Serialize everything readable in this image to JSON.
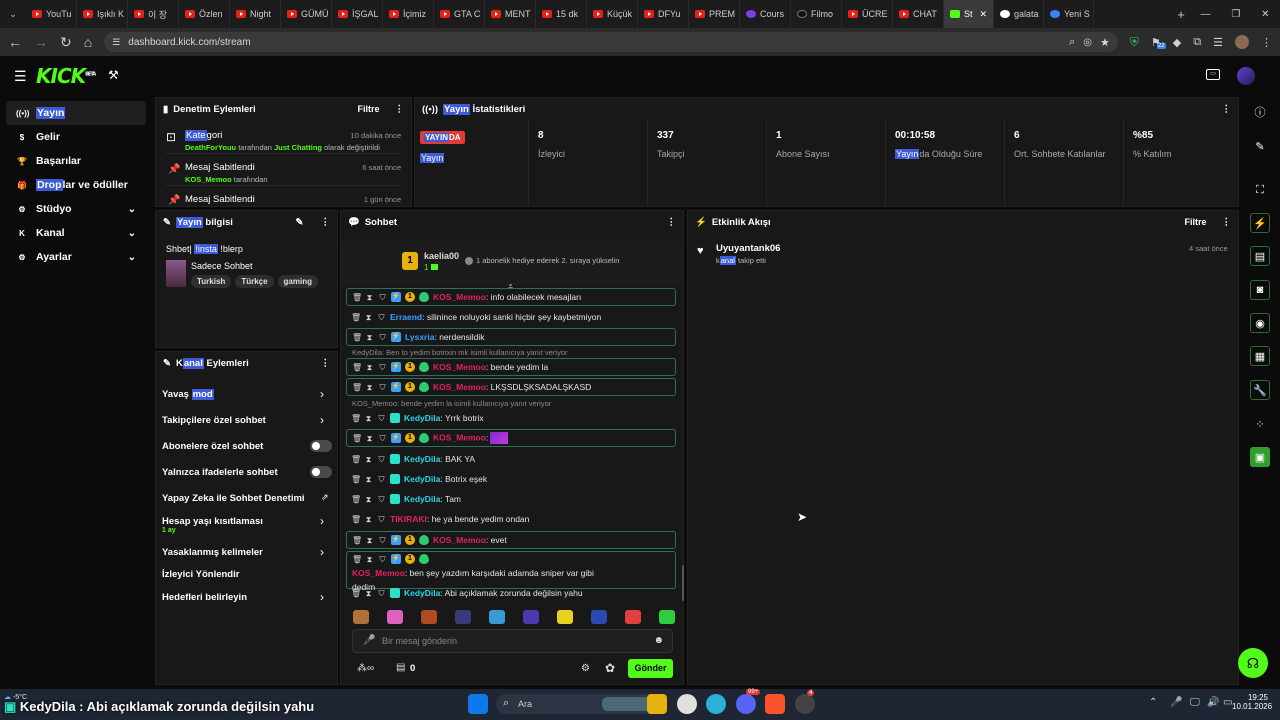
{
  "browser": {
    "tabs": [
      "YouTu",
      "Işıklı K",
      "이 장",
      "Özlen",
      "Night",
      "GÜMÜ",
      "İŞGAL",
      "İçimiz",
      "GTA C",
      "MENT",
      "15 dk",
      "Küçük",
      "DFYu",
      "PREM",
      "Cours",
      "Filmo",
      "ÜCRE",
      "CHAT",
      "St",
      "galata",
      "Yeni S"
    ],
    "url": "dashboard.kick.com/stream",
    "ext_badge": "22"
  },
  "app": {
    "logo": "KICK",
    "beta": "BETA",
    "sidebar": [
      {
        "label_hl": "Yayın",
        "label": "",
        "icon": "broadcast-icon"
      },
      {
        "label_hl": "",
        "label": "Gelir",
        "icon": "dollar-icon"
      },
      {
        "label_hl": "",
        "label": "Başarılar",
        "icon": "trophy-icon"
      },
      {
        "label_hl": "Drop",
        "label": "lar ve ödüller",
        "icon": "gift-icon"
      },
      {
        "label_hl": "",
        "label": "Stüdyo",
        "icon": "gear-icon"
      },
      {
        "label_hl": "",
        "label": "Kanal",
        "icon": "channel-icon"
      },
      {
        "label_hl": "",
        "label": "Ayarlar",
        "icon": "settings-icon"
      }
    ],
    "moderation": {
      "title": "Denetim Eylemleri",
      "filter": "Filtre",
      "items": [
        {
          "title_hl": "Kate",
          "title": "gori",
          "time": "10 dakika önce",
          "line_a": "DeathForYouu",
          "line_b": " tarafından ",
          "line_c": "Just Chatting",
          "line_d": " olarak değiştirildi"
        },
        {
          "title": "Mesaj Sabitlendi",
          "time": "6 saat önce",
          "line_a": "KOS_Memoo",
          "line_b": " tarafından"
        },
        {
          "title": "Mesaj Sabitlendi",
          "time": "1 gün önce"
        }
      ]
    },
    "stats": {
      "title_hl": "Yayın",
      "title": " İstatistikleri",
      "live_badge_hl": "YAYIN",
      "live_badge": "DA",
      "live_sub": "Yayın",
      "items": [
        {
          "value": "8",
          "label": "İzleyici"
        },
        {
          "value": "337",
          "label": "Takipçi"
        },
        {
          "value": "1",
          "label": "Abone Sayısı"
        },
        {
          "value": "00:10:58",
          "label_hl": "Yayın",
          "label": "da Olduğu Süre"
        },
        {
          "value": "6",
          "label": "Ort. Sohbete Katılanlar"
        },
        {
          "value": "%85",
          "label": "% Katılım"
        }
      ]
    },
    "stream_info": {
      "title_hl": "Yayın",
      "title": " bilgisi",
      "stream_title_a": "Shbet| ",
      "stream_title_hl": "!insta",
      "stream_title_b": " !blerp",
      "category": "Sadece Sohbet",
      "tags": [
        "Turkish",
        "Türkçe",
        "gaming"
      ]
    },
    "channel_actions": {
      "title_hl": "anal",
      "title_pre": "K",
      "title": " Eylemleri",
      "items": [
        {
          "label_a": "Yavaş ",
          "label_hl": "mod",
          "type": "chev"
        },
        {
          "label_a": "Takipçilere özel sohbet",
          "type": "chev"
        },
        {
          "label_a": "Abonelere özel sohbet",
          "type": "toggle"
        },
        {
          "label_a": "Yalnızca ifadelerle sohbet",
          "type": "toggle"
        },
        {
          "label_a": "Yapay Zeka ile Sohbet Denetimi",
          "type": "ext"
        },
        {
          "label_a": "Hesap yaşı kısıtlaması",
          "sub": "1 ay",
          "type": "chev"
        },
        {
          "label_a": "Yasaklanmış kelimeler",
          "type": "chev"
        },
        {
          "label_a": "İzleyici Yönlendir",
          "type": "none"
        },
        {
          "label_a": "Hedefleri belirleyin",
          "type": "chev"
        }
      ]
    },
    "chat": {
      "title": "Sohbet",
      "pinned_user": "kaelia00",
      "pinned_level": "1",
      "pinned_msg": "1 abonelik hediye ederek 2. sıraya yükselin",
      "messages": [
        {
          "user": "KOS_Memoo",
          "text": ": info olabilecek mesajları"
        },
        {
          "user": "Erraend",
          "text": ": silinince noluyoki sanki hiçbir şey kaybetmiyon"
        },
        {
          "user": "Lysxria",
          "text": ": nerdensildik"
        },
        {
          "reply": "KedyDila: Ben to yedim botrixin mk isimli kullanıcıya yanıt veriyor",
          "user": "KOS_Memoo",
          "text": ": bende yedim la"
        },
        {
          "user": "KOS_Memoo",
          "text": ": LKŞSDLŞKSADALŞKASD"
        },
        {
          "reply": "KOS_Memoo: bende yedim la isimli kullanıcıya yanıt veriyor",
          "user": "KedyDila",
          "text": ": Yrrk botrix"
        },
        {
          "user": "KOS_Memoo",
          "text": ":"
        },
        {
          "user": "KedyDila",
          "text": ": BAK YA"
        },
        {
          "user": "KedyDila",
          "text": ": Botrix eşek"
        },
        {
          "user": "KedyDila",
          "text": ": Tam"
        },
        {
          "user": "TIKIRAKI",
          "text": ": he ya bende yedim ondan"
        },
        {
          "user": "KOS_Memoo",
          "text": ": evet"
        },
        {
          "user": "KOS_Memoo",
          "text": ": ben şey yazdım karşıdaki adamda sniper var gibi",
          "text2": "dedim"
        },
        {
          "user": "KedyDila",
          "text": ": Abi açıklamak zorunda değilsin yahu"
        }
      ],
      "placeholder": "Bir mesaj gönderin",
      "points": "0",
      "send": "Gönder"
    },
    "activity": {
      "title": "Etkinlik Akışı",
      "filter": "Filtre",
      "user": "Uyuyantank06",
      "action_pre": "k",
      "action_hl": "anal",
      "action": " takip etti",
      "time": "4 saat önce"
    }
  },
  "taskbar": {
    "weather": "-5°C",
    "overlay": "KedyDila : Abi açıklamak zorunda değilsin yahu",
    "search": "Ara",
    "time": "19:25",
    "date": "10.01.2026",
    "badge_a": "99+",
    "badge_b": "4"
  },
  "colors": {
    "accent": "#53fc18",
    "highlight": "#3d5bd9",
    "live": "#e53935"
  }
}
